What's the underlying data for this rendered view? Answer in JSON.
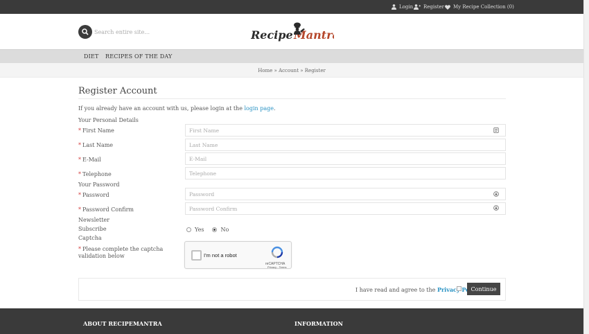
{
  "topbar": {
    "login": "Login",
    "register": "Register",
    "collection": "My Recipe Collection (0)"
  },
  "search": {
    "placeholder": "Search entire site..."
  },
  "logo": {
    "text_left": "Recipe",
    "text_right": "Mantra",
    "color_dark": "#2b2b2b",
    "color_accent": "#b5472b"
  },
  "nav": {
    "items": [
      "DIET",
      "RECIPES OF THE DAY"
    ]
  },
  "breadcrumb": {
    "home": "Home",
    "sep": "»",
    "account": "Account",
    "register": "Register"
  },
  "page": {
    "title": "Register Account",
    "intro_text": "If you already have an account with us, please login at the",
    "intro_link": "login page",
    "intro_end": "."
  },
  "form": {
    "personal_legend": "Your Personal Details",
    "required_mark": "*",
    "firstname_label": "First Name",
    "firstname_placeholder": "First Name",
    "lastname_label": "Last Name",
    "lastname_placeholder": "Last Name",
    "email_label": "E-Mail",
    "email_placeholder": "E-Mail",
    "telephone_label": "Telephone",
    "telephone_placeholder": "Telephone",
    "password_legend": "Your Password",
    "password_label": "Password",
    "password_placeholder": "Password",
    "confirm_label": "Password Confirm",
    "confirm_placeholder": "Password Confirm",
    "newsletter_legend": "Newsletter",
    "subscribe_label": "Subscribe",
    "yes": "Yes",
    "no": "No",
    "captcha_legend": "Captcha",
    "captcha_label": "Please complete the captcha validation below",
    "captcha_text": "I'm not a robot",
    "captcha_brand": "reCAPTCHA",
    "captcha_terms": "Privacy - Terms"
  },
  "agree": {
    "text": "I have read and agree to the",
    "link": "Privacy Policy",
    "button": "Continue"
  },
  "footer": {
    "about": "ABOUT RECIPEMANTRA",
    "information": "INFORMATION"
  }
}
